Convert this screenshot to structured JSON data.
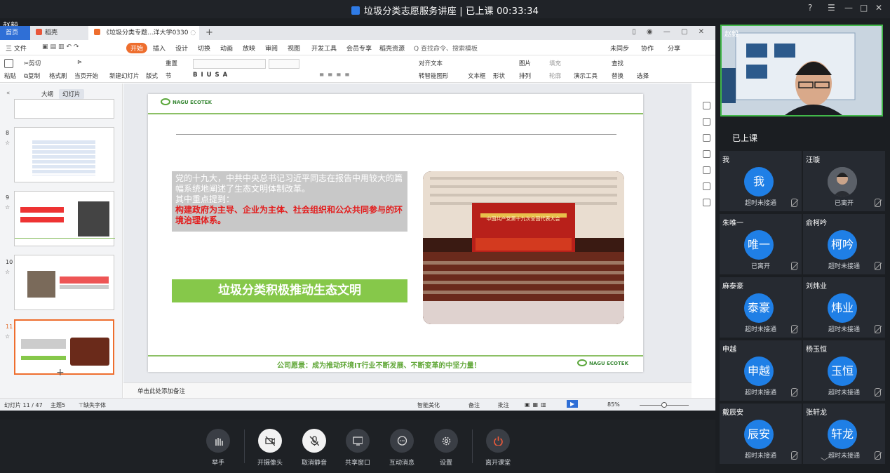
{
  "window": {
    "title": "垃圾分类志愿服务讲座 | 已上课 00:33:34",
    "controls": [
      "?",
      "☰",
      "—",
      "□",
      "✕"
    ]
  },
  "presenter_name": "赵毅",
  "wps": {
    "tabs": [
      "首页",
      "稻壳",
      "《垃圾分类专题...洋大学0330"
    ],
    "menus": [
      "三 文件",
      "开始",
      "插入",
      "设计",
      "切换",
      "动画",
      "放映",
      "审阅",
      "视图",
      "开发工具",
      "会员专享",
      "稻壳资源",
      "Q 查找命令、搜索模板"
    ],
    "menu_right": [
      "未同步",
      "协作",
      "分享"
    ],
    "ribbon": {
      "paste": "粘贴",
      "cut": "剪切",
      "copy": "复制",
      "format_brush": "格式刷",
      "from_current": "当页开始",
      "new_slide": "新建幻灯片",
      "layout": "版式",
      "reset": "重置",
      "section": "节",
      "align_text": "对齐文本",
      "smart_art": "转智能图形",
      "textbox": "文本框",
      "shape": "形状",
      "picture": "图片",
      "arrange": "排列",
      "fill": "填充",
      "outline": "轮廓",
      "present_tools": "演示工具",
      "find": "查找",
      "replace": "替换",
      "select": "选择"
    },
    "leftpane": {
      "outline_tab": "大纲",
      "slides_tab": "幻灯片",
      "slide_numbers": [
        "8",
        "9",
        "10",
        "11"
      ]
    },
    "slide": {
      "logo_text": "NAGU ECOTEK",
      "body_line1": "党的十九大，中共中央总书记习近平同志在报告中用较大的篇幅系统地阐述了生态文明体制改革。",
      "body_line2": "其中重点提到：",
      "body_red": "构建政府为主导、企业为主体、社会组织和公众共同参与的环境治理体系。",
      "banner": "垃圾分类积极推动生态文明",
      "photo_caption": "中国共产党第十九次全国代表大会",
      "vision": "公司愿景：成为推动环境IT行业不断发展、不断变革的中坚力量！"
    },
    "notes_placeholder": "单击此处添加备注",
    "status": {
      "slide_count": "幻灯片 11 / 47",
      "theme": "主题5",
      "missing_font": "缺失字体",
      "smart_beautify": "智能美化",
      "notes": "备注",
      "comments": "批注",
      "zoom": "85%"
    }
  },
  "controls": [
    {
      "label": "举手"
    },
    {
      "label": "开摄像头"
    },
    {
      "label": "取消静音"
    },
    {
      "label": "共享窗口"
    },
    {
      "label": "互动消息"
    },
    {
      "label": "设置"
    },
    {
      "label": "离开课堂"
    }
  ],
  "camera_name": "赵毅",
  "class_status": "已上课",
  "participants": [
    {
      "name": "我",
      "avatar": "我",
      "status": "超时未接通"
    },
    {
      "name": "汪璇",
      "avatar": "",
      "status": "已离开"
    },
    {
      "name": "朱唯一",
      "avatar": "唯一",
      "status": "已离开"
    },
    {
      "name": "俞柯吟",
      "avatar": "柯吟",
      "status": "超时未接通"
    },
    {
      "name": "麻泰豪",
      "avatar": "泰豪",
      "status": "超时未接通"
    },
    {
      "name": "刘炜业",
      "avatar": "炜业",
      "status": "超时未接通"
    },
    {
      "name": "申越",
      "avatar": "申越",
      "status": "超时未接通"
    },
    {
      "name": "杨玉恒",
      "avatar": "玉恒",
      "status": "超时未接通"
    },
    {
      "name": "戴辰安",
      "avatar": "辰安",
      "status": "超时未接通"
    },
    {
      "name": "张轩龙",
      "avatar": "轩龙",
      "status": "超时未接通"
    }
  ],
  "colors": {
    "accent_blue": "#1f7fe6",
    "active_green": "#42b84a",
    "slide_green": "#86c84a",
    "slide_red": "#e31b1b"
  }
}
